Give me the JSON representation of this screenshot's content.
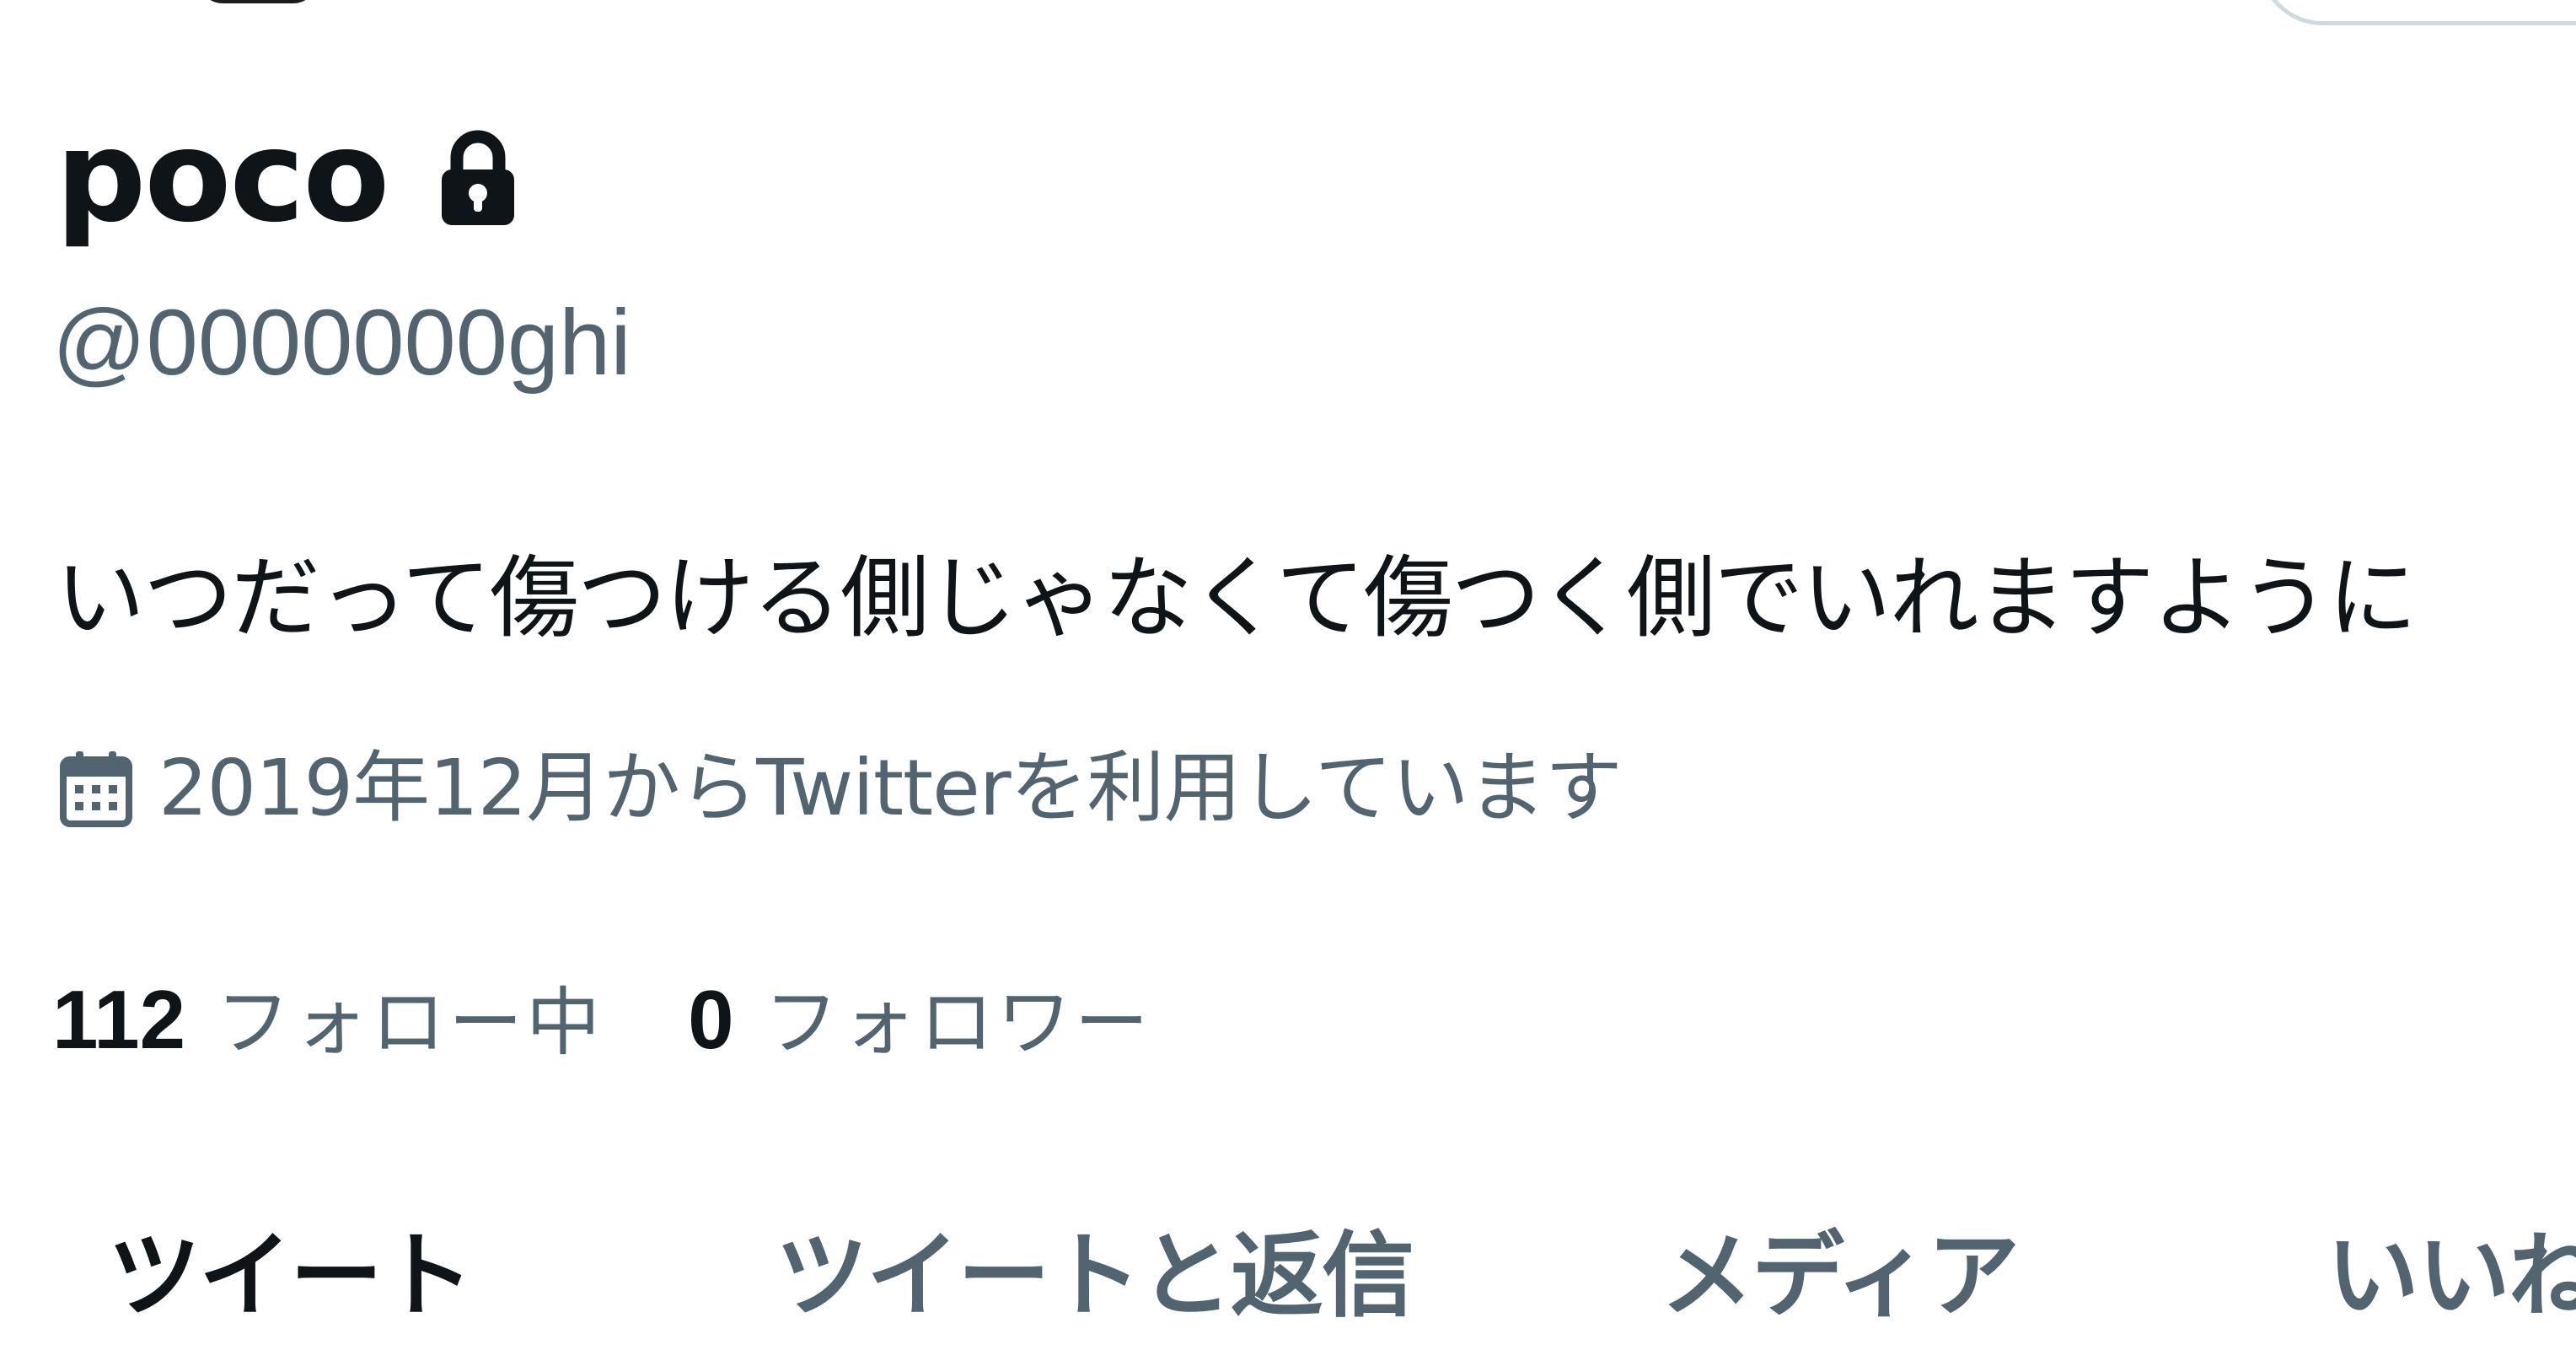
{
  "profile": {
    "display_name": "poco",
    "handle": "@0000000ghi",
    "bio": "いつだって傷つける側じゃなくて傷つく側でいれますように",
    "joined": "2019年12月からTwitterを利用しています",
    "following_count": "112",
    "following_label": "フォロー中",
    "followers_count": "0",
    "followers_label": "フォロワー",
    "protected_icon": "lock-icon",
    "joined_icon": "calendar-icon"
  },
  "tabs": [
    {
      "label": "ツイート",
      "active": true
    },
    {
      "label": "ツイートと返信",
      "active": false
    },
    {
      "label": "メディア",
      "active": false
    },
    {
      "label": "いいね",
      "active": false
    }
  ],
  "colors": {
    "primary_text": "#0f1419",
    "secondary_text": "#536471",
    "border": "#cfd9de",
    "background": "#ffffff"
  }
}
